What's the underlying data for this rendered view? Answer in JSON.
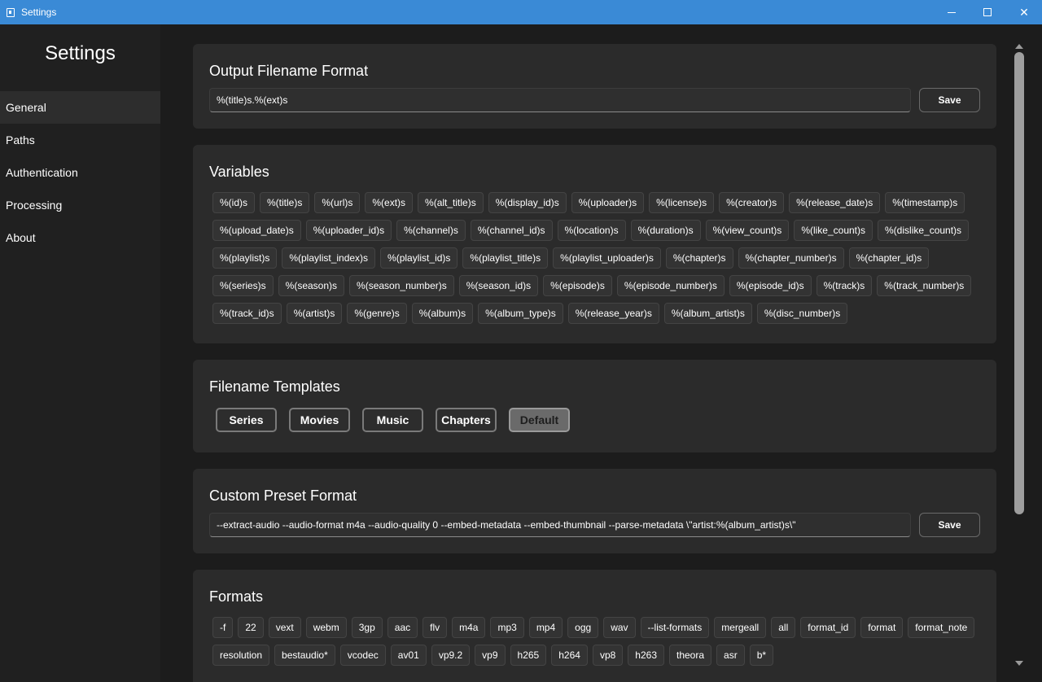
{
  "window": {
    "title": "Settings",
    "icon": "film-icon"
  },
  "sidebar": {
    "heading": "Settings",
    "items": [
      {
        "label": "General",
        "active": true
      },
      {
        "label": "Paths"
      },
      {
        "label": "Authentication"
      },
      {
        "label": "Processing"
      },
      {
        "label": "About"
      }
    ]
  },
  "output_format": {
    "title": "Output Filename Format",
    "value": "%(title)s.%(ext)s",
    "save_label": "Save"
  },
  "variables": {
    "title": "Variables",
    "items": [
      "%(id)s",
      "%(title)s",
      "%(url)s",
      "%(ext)s",
      "%(alt_title)s",
      "%(display_id)s",
      "%(uploader)s",
      "%(license)s",
      "%(creator)s",
      "%(release_date)s",
      "%(timestamp)s",
      "%(upload_date)s",
      "%(uploader_id)s",
      "%(channel)s",
      "%(channel_id)s",
      "%(location)s",
      "%(duration)s",
      "%(view_count)s",
      "%(like_count)s",
      "%(dislike_count)s",
      "%(playlist)s",
      "%(playlist_index)s",
      "%(playlist_id)s",
      "%(playlist_title)s",
      "%(playlist_uploader)s",
      "%(chapter)s",
      "%(chapter_number)s",
      "%(chapter_id)s",
      "%(series)s",
      "%(season)s",
      "%(season_number)s",
      "%(season_id)s",
      "%(episode)s",
      "%(episode_number)s",
      "%(episode_id)s",
      "%(track)s",
      "%(track_number)s",
      "%(track_id)s",
      "%(artist)s",
      "%(genre)s",
      "%(album)s",
      "%(album_type)s",
      "%(release_year)s",
      "%(album_artist)s",
      "%(disc_number)s"
    ]
  },
  "templates": {
    "title": "Filename Templates",
    "buttons": [
      "Series",
      "Movies",
      "Music",
      "Chapters",
      "Default"
    ],
    "selected": "Default"
  },
  "custom_preset": {
    "title": "Custom Preset Format",
    "value": "--extract-audio --audio-format m4a --audio-quality 0 --embed-metadata --embed-thumbnail --parse-metadata \\\"artist:%(album_artist)s\\\"",
    "save_label": "Save"
  },
  "formats": {
    "title": "Formats",
    "items": [
      "-f",
      "22",
      "vext",
      "webm",
      "3gp",
      "aac",
      "flv",
      "m4a",
      "mp3",
      "mp4",
      "ogg",
      "wav",
      "--list-formats",
      "mergeall",
      "all",
      "format_id",
      "format",
      "format_note",
      "resolution",
      "bestaudio*",
      "vcodec",
      "av01",
      "vp9.2",
      "vp9",
      "h265",
      "h264",
      "vp8",
      "h263",
      "theora",
      "asr",
      "b*"
    ]
  }
}
